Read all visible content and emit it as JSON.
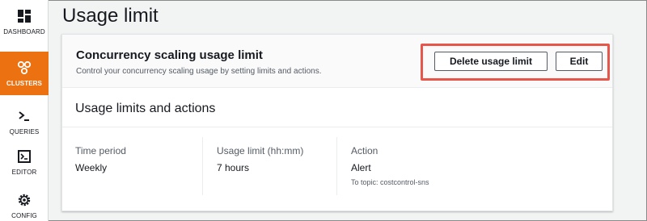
{
  "sidebar": {
    "items": [
      {
        "label": "DASHBOARD",
        "icon": "dashboard-grid-icon",
        "active": false
      },
      {
        "label": "CLUSTERS",
        "icon": "clusters-icon",
        "active": true
      },
      {
        "label": "QUERIES",
        "icon": "queries-prompt-icon",
        "active": false
      },
      {
        "label": "EDITOR",
        "icon": "editor-terminal-icon",
        "active": false
      },
      {
        "label": "CONFIG",
        "icon": "config-gear-icon",
        "active": false
      }
    ]
  },
  "page": {
    "title": "Usage limit"
  },
  "card": {
    "title": "Concurrency scaling usage limit",
    "description": "Control your concurrency scaling usage by setting limits and actions.",
    "buttons": {
      "delete_label": "Delete usage limit",
      "edit_label": "Edit"
    }
  },
  "section": {
    "title": "Usage limits and actions",
    "columns": [
      {
        "key": "Time period",
        "value": "Weekly"
      },
      {
        "key": "Usage limit (hh:mm)",
        "value": "7 hours"
      },
      {
        "key": "Action",
        "value": "Alert",
        "sub": "To topic: costcontrol-sns"
      }
    ]
  },
  "colors": {
    "accent": "#ec7211",
    "highlight": "#e7564a",
    "text": "#16191f",
    "muted": "#545b64"
  }
}
